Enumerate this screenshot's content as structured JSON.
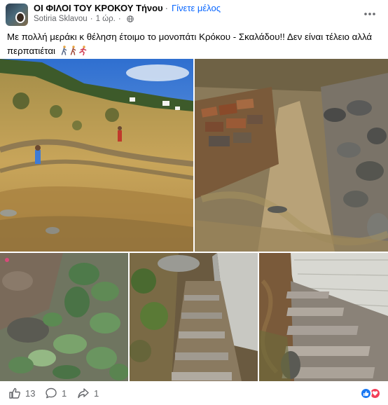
{
  "group": {
    "name": "ΟΙ ΦΙΛΟΙ ΤΟΥ ΚΡΟΚΟΥ Τήνου",
    "join_label": "Γίνετε μέλος"
  },
  "author": {
    "name": "Sotiria Sklavou",
    "time": "1 ώρ."
  },
  "post": {
    "text": "Με πολλή μεράκι κ θέληση έτοιμο το μονοπάτι Κρόκου - Σκαλάδου!! Δεν είναι τέλειο αλλά περπατιέται"
  },
  "stats": {
    "likes": "13",
    "comments": "1",
    "shares": "1"
  },
  "icons": {
    "more": "more-dots-icon",
    "privacy": "globe-icon",
    "like": "thumbs-up-icon",
    "comment": "comment-bubble-icon",
    "share": "share-arrow-icon",
    "reaction_like": "like-reaction-icon",
    "reaction_love": "love-reaction-icon",
    "emoji": [
      "person-walking-icon",
      "person-walking-icon",
      "person-running-icon"
    ]
  },
  "colors": {
    "link": "#0866ff",
    "meta": "#65676b",
    "like": "#1877f2",
    "love": "#f33e58"
  }
}
